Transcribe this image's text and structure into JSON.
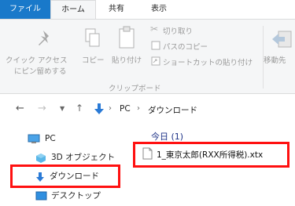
{
  "ribbon_tabs": {
    "file": "ファイル",
    "home": "ホーム",
    "share": "共有",
    "view": "表示"
  },
  "ribbon": {
    "quick_access_line1": "クイック アクセス",
    "quick_access_line2": "にピン留めする",
    "copy": "コピー",
    "paste": "貼り付け",
    "cut": "切り取り",
    "copy_path": "パスのコピー",
    "paste_shortcut": "ショートカットの貼り付け",
    "move_to": "移動先",
    "group_clipboard": "クリップボード"
  },
  "address_bar": {
    "crumbs": [
      "PC",
      "ダウンロード"
    ]
  },
  "nav_pane": {
    "items": [
      {
        "label": "PC",
        "icon": "monitor-icon"
      },
      {
        "label": "3D オブジェクト",
        "icon": "cube-icon"
      },
      {
        "label": "ダウンロード",
        "icon": "download-arrow-icon"
      },
      {
        "label": "デスクトップ",
        "icon": "desktop-icon"
      }
    ]
  },
  "content": {
    "group_header": "今日 (1)",
    "file_name": "1_東京太郎(RXX所得税).xtx"
  },
  "colors": {
    "accent": "#1979ca",
    "highlight": "#ff1010"
  }
}
